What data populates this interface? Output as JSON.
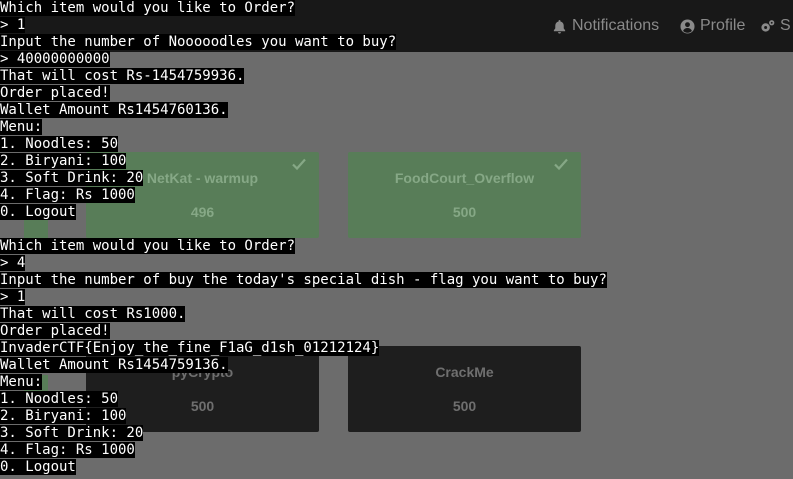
{
  "nav": {
    "notifications": "Notifications",
    "profile": "Profile",
    "settings": "S"
  },
  "cards": [
    {
      "name": "NetKat - warmup",
      "points": "496",
      "solved": true
    },
    {
      "name": "FoodCourt_Overflow",
      "points": "500",
      "solved": true
    },
    {
      "name": "pyCrypto",
      "points": "500",
      "solved": false
    },
    {
      "name": "CrackMe",
      "points": "500",
      "solved": false
    }
  ],
  "terminal": {
    "lines": [
      "Which item would you like to Order?",
      "> 1",
      "Input the number of Nooooodles you want to buy?",
      "> 40000000000",
      "That will cost Rs-1454759936.",
      "Order placed!",
      "Wallet Amount Rs1454760136.",
      "Menu:",
      "1. Noodles: 50",
      "2. Biryani: 100",
      "3. Soft Drink: 20",
      "4. Flag: Rs 1000",
      "0. Logout",
      "",
      "Which item would you like to Order?",
      "> 4",
      "Input the number of buy the today's special dish - flag you want to buy?",
      "> 1",
      "That will cost Rs1000.",
      "Order placed!",
      "InvaderCTF{Enjoy_the_fine_F1aG_d1sh_01212124}",
      "Wallet Amount Rs1454759136.",
      "Menu:",
      "1. Noodles: 50",
      "2. Biryani: 100",
      "3. Soft Drink: 20",
      "4. Flag: Rs 1000",
      "0. Logout"
    ]
  },
  "colors": {
    "terminal_bg": "#000000",
    "terminal_fg": "#ffffff",
    "solved_card": "#587d58",
    "unsolved_card": "#1e1e1e",
    "navbar": "#181818"
  }
}
